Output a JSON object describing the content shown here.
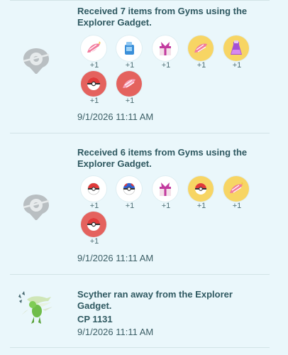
{
  "entries": [
    {
      "title": "Received 7 items from Gyms using the Explorer Gadget.",
      "timestamp": "9/1/2026 11:11 AM",
      "items": [
        {
          "icon": "berry-icon",
          "qty": "+1",
          "bg": "white"
        },
        {
          "icon": "hyper-potion-icon",
          "qty": "+1",
          "bg": "white"
        },
        {
          "icon": "gift-icon",
          "qty": "+1",
          "bg": "white"
        },
        {
          "icon": "berry-icon",
          "qty": "+1",
          "bg": "gold"
        },
        {
          "icon": "potion-icon",
          "qty": "+1",
          "bg": "gold"
        },
        {
          "icon": "poke-ball-icon",
          "qty": "+1",
          "bg": "red"
        },
        {
          "icon": "berry-icon",
          "qty": "+1",
          "bg": "red"
        }
      ]
    },
    {
      "title": "Received 6 items from Gyms using the Explorer Gadget.",
      "timestamp": "9/1/2026 11:11 AM",
      "items": [
        {
          "icon": "poke-ball-icon",
          "qty": "+1",
          "bg": "white"
        },
        {
          "icon": "great-ball-icon",
          "qty": "+1",
          "bg": "white"
        },
        {
          "icon": "gift-icon",
          "qty": "+1",
          "bg": "white"
        },
        {
          "icon": "poke-ball-icon",
          "qty": "+1",
          "bg": "gold"
        },
        {
          "icon": "berry-icon",
          "qty": "+1",
          "bg": "gold"
        },
        {
          "icon": "poke-ball-icon",
          "qty": "+1",
          "bg": "red"
        }
      ]
    },
    {
      "title": "Scyther ran away from the Explorer Gadget.",
      "cp": "CP 1131",
      "timestamp": "9/1/2026 11:11 AM",
      "icon": "scyther-icon"
    }
  ],
  "colors": {
    "background": "#eaf7fb",
    "text": "#2f5961",
    "gold_bubble": "#f7d564",
    "red_bubble": "#e4625e"
  }
}
